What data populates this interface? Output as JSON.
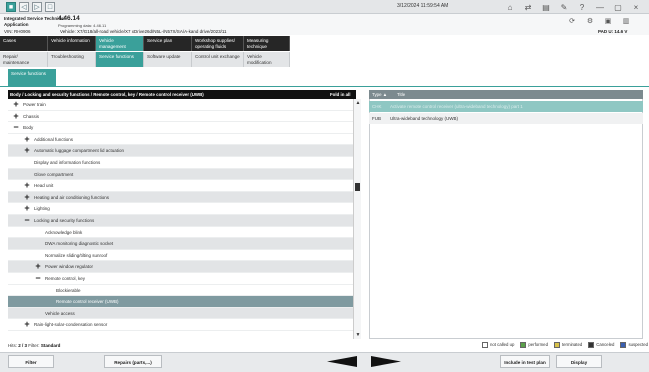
{
  "system": {
    "datetime": "3/12/2024 11:59:54 AM"
  },
  "app": {
    "name_line1": "Integrated Service Technical",
    "name_line2": "Application",
    "version": "4.46.14",
    "programming_label": "Programming data: 4.46.11",
    "vin_label": "VIN: RH0906",
    "vehicle_label": "Vehicle: X7/G18/all-road vehicle/X7 xDrive26d/N5L-/N57X/SA/A-kand drive/2023/11",
    "pad_status": "PAD U: 14.6 V"
  },
  "nav_main": [
    {
      "label": "Cases"
    },
    {
      "label": "Vehicle information"
    },
    {
      "label": "Vehicle management"
    },
    {
      "label": "Service plan"
    },
    {
      "label": "Workshop supplies/ operating fluids"
    },
    {
      "label": "Measuring technique"
    }
  ],
  "nav_sub": [
    {
      "label": "Repair/ maintenance"
    },
    {
      "label": "Troubleshooting"
    },
    {
      "label": "Service functions"
    },
    {
      "label": "Software update"
    },
    {
      "label": "Control unit exchange"
    },
    {
      "label": "Vehicle modification"
    }
  ],
  "service_tab": "Service functions",
  "left_header": "Body / Locking and security functions / Remote control, key / Remote control receiver (UWB)",
  "fold_all": "Fold in all",
  "tree": [
    {
      "label": "Power train",
      "sign": "+",
      "level": 0,
      "style": "plain"
    },
    {
      "label": "Chassis",
      "sign": "+",
      "level": 0,
      "style": "plain"
    },
    {
      "label": "Body",
      "sign": "−",
      "level": 0,
      "style": "plain"
    },
    {
      "label": "Additional functions",
      "sign": "+",
      "level": 1,
      "style": "plain"
    },
    {
      "label": "Automatic luggage compartment lid actuation",
      "sign": "+",
      "level": 1,
      "style": "grey"
    },
    {
      "label": "Display and information functions",
      "sign": "",
      "level": 1,
      "style": "plain"
    },
    {
      "label": "Glove compartment",
      "sign": "",
      "level": 1,
      "style": "grey"
    },
    {
      "label": "Head unit",
      "sign": "+",
      "level": 1,
      "style": "plain"
    },
    {
      "label": "Heating and air conditioning functions",
      "sign": "+",
      "level": 1,
      "style": "grey"
    },
    {
      "label": "Lighting",
      "sign": "+",
      "level": 1,
      "style": "plain"
    },
    {
      "label": "Locking and security functions",
      "sign": "−",
      "level": 1,
      "style": "grey"
    },
    {
      "label": "Acknowledge blink",
      "sign": "",
      "level": 2,
      "style": "plain"
    },
    {
      "label": "DWA monitoring diagnostic socket",
      "sign": "",
      "level": 2,
      "style": "grey"
    },
    {
      "label": "Normalize sliding/tilting sunroof",
      "sign": "",
      "level": 2,
      "style": "plain"
    },
    {
      "label": "Power window regulator",
      "sign": "+",
      "level": 2,
      "style": "grey"
    },
    {
      "label": "Remote control, key",
      "sign": "−",
      "level": 2,
      "style": "plain"
    },
    {
      "label": "Blockierable",
      "sign": "",
      "level": 3,
      "style": "plain"
    },
    {
      "label": "Remote control receiver (UWB)",
      "sign": "",
      "level": 3,
      "style": "sel"
    },
    {
      "label": "Vehicle access",
      "sign": "",
      "level": 2,
      "style": "grey"
    },
    {
      "label": "Rain-light-solar-condensation sensor",
      "sign": "+",
      "level": 1,
      "style": "plain"
    }
  ],
  "right_header": {
    "type": "Type ▲",
    "title": "Title"
  },
  "right_rows": [
    {
      "type": "CHK",
      "title": "Activate remote control receiver (ultra-wideband technology) part 1"
    },
    {
      "type": "FUB",
      "title": "Ultra-wideband technology (UWB)"
    }
  ],
  "status": {
    "hits_label": "Hits:",
    "hits_value": "2 / 3",
    "filter_label": "Filter:",
    "filter_value": "Standard"
  },
  "legend": [
    {
      "label": "not called up",
      "color": "#ffffff"
    },
    {
      "label": "performed",
      "color": "#5aa04a"
    },
    {
      "label": "terminated",
      "color": "#d8c24a"
    },
    {
      "label": "Canceled",
      "color": "#333333"
    },
    {
      "label": "suspected",
      "color": "#3a5fb0"
    }
  ],
  "buttons": {
    "filter": "Filter",
    "repairs": "Repairs (parts,...)",
    "include": "Include in test plan",
    "display": "Display"
  }
}
